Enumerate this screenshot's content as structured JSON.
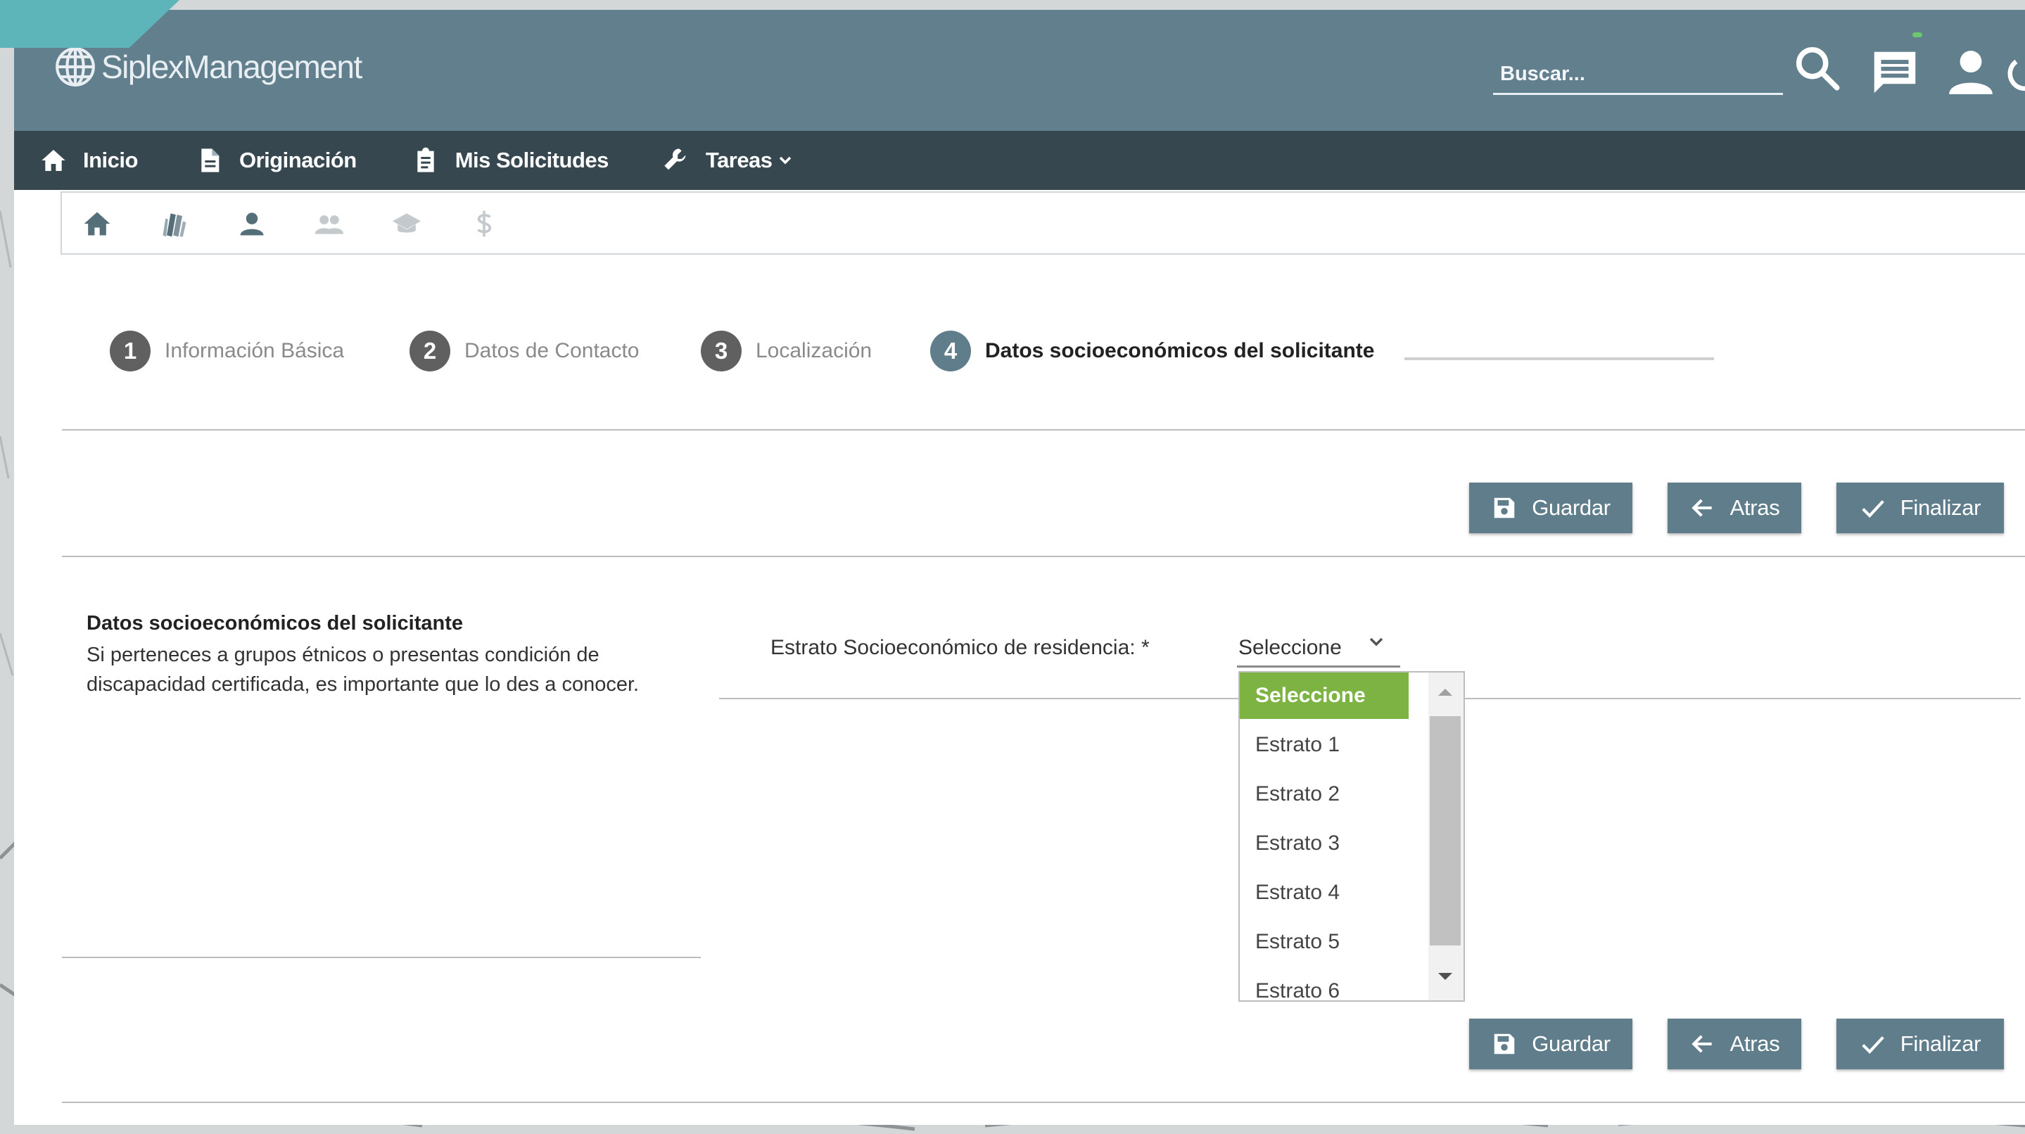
{
  "app": {
    "brand": "SiplexManagement"
  },
  "header": {
    "search_placeholder": "Buscar..."
  },
  "nav": {
    "items": [
      {
        "label": "Inicio",
        "icon": "home-icon"
      },
      {
        "label": "Originación",
        "icon": "document-icon"
      },
      {
        "label": "Mis Solicitudes",
        "icon": "clipboard-icon"
      },
      {
        "label": "Tareas",
        "icon": "wrench-icon",
        "dropdown": true
      }
    ]
  },
  "icon_tabs": [
    "home-icon",
    "books-icon",
    "person-icon",
    "people-icon",
    "graduation-cap-icon",
    "dollar-icon"
  ],
  "stepper": {
    "steps": [
      {
        "num": "1",
        "label": "Información Básica"
      },
      {
        "num": "2",
        "label": "Datos de Contacto"
      },
      {
        "num": "3",
        "label": "Localización"
      },
      {
        "num": "4",
        "label": "Datos socioeconómicos del solicitante",
        "active": true
      }
    ]
  },
  "actions": {
    "save": "Guardar",
    "back": "Atras",
    "finish": "Finalizar"
  },
  "section": {
    "title": "Datos socioeconómicos del solicitante",
    "description": "Si perteneces a grupos étnicos o presentas condición de discapacidad certificada, es importante que lo des a conocer."
  },
  "field": {
    "label": "Estrato Socioeconómico de residencia: *",
    "value": "Seleccione",
    "options": [
      "Seleccione",
      "Estrato 1",
      "Estrato 2",
      "Estrato 3",
      "Estrato 4",
      "Estrato 5",
      "Estrato 6"
    ],
    "selected_index": 0
  },
  "colors": {
    "header": "#627f8e",
    "nav": "#37474f",
    "button": "#607d8b",
    "selected_option": "#7cb342"
  }
}
